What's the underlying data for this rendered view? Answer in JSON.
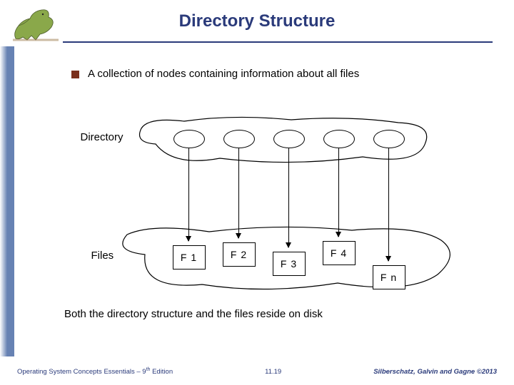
{
  "title": "Directory Structure",
  "bullet": "A collection of nodes containing information about all files",
  "labels": {
    "directory": "Directory",
    "files": "Files"
  },
  "files": [
    "F 1",
    "F 2",
    "F 3",
    "F 4",
    "F n"
  ],
  "closing": "Both the directory structure and the files reside on disk",
  "footer": {
    "left_a": "Operating System Concepts Essentials – 9",
    "left_b": " Edition",
    "left_sup": "th",
    "center": "11.19",
    "right": "Silberschatz, Galvin and Gagne ©2013"
  }
}
